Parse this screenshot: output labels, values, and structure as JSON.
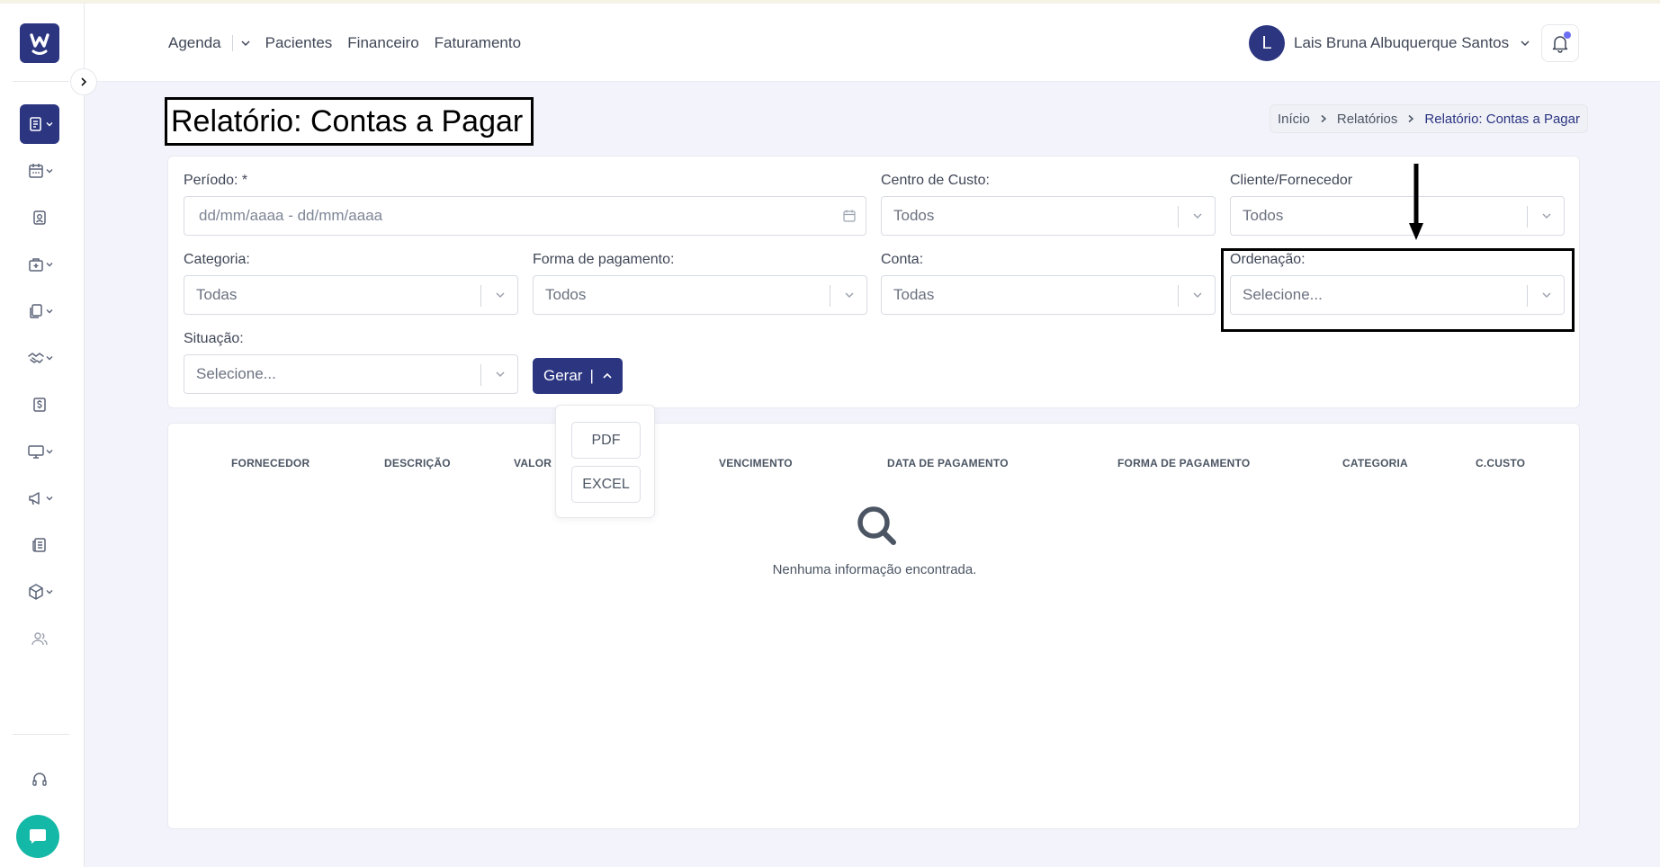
{
  "header": {
    "nav": [
      "Agenda",
      "Pacientes",
      "Financeiro",
      "Faturamento"
    ],
    "user_initial": "L",
    "user_name": "Lais Bruna Albuquerque Santos"
  },
  "page": {
    "title": "Relatório: Contas a Pagar",
    "breadcrumb": [
      "Início",
      "Relatórios",
      "Relatório: Contas a Pagar"
    ]
  },
  "filters": {
    "periodo": {
      "label": "Período: *",
      "placeholder": "dd/mm/aaaa - dd/mm/aaaa"
    },
    "centro_custo": {
      "label": "Centro de Custo:",
      "value": "Todos"
    },
    "cliente_fornecedor": {
      "label": "Cliente/Fornecedor",
      "value": "Todos"
    },
    "categoria": {
      "label": "Categoria:",
      "value": "Todas"
    },
    "forma_pagamento": {
      "label": "Forma de pagamento:",
      "value": "Todos"
    },
    "conta": {
      "label": "Conta:",
      "value": "Todas"
    },
    "ordenacao": {
      "label": "Ordenação:",
      "value": "Selecione..."
    },
    "situacao": {
      "label": "Situação:",
      "value": "Selecione..."
    }
  },
  "gerar": {
    "label": "Gerar",
    "separator": "|",
    "options": [
      "PDF",
      "EXCEL"
    ]
  },
  "table": {
    "columns": [
      "FORNECEDOR",
      "DESCRIÇÃO",
      "VALOR",
      "VENCIMENTO",
      "DATA DE PAGAMENTO",
      "FORMA DE PAGAMENTO",
      "CATEGORIA",
      "C.CUSTO"
    ],
    "empty_message": "Nenhuma informação encontrada."
  },
  "colors": {
    "primary": "#2b3580",
    "chat": "#14b8a6",
    "notification": "#6d6ff3"
  },
  "icons": {
    "sidebar": [
      "report-icon",
      "calendar-icon",
      "patient-icon",
      "medical-kit-icon",
      "documents-icon",
      "handshake-icon",
      "dollar-icon",
      "monitor-icon",
      "megaphone-icon",
      "newspaper-icon",
      "box-icon",
      "users-icon",
      "headset-icon"
    ]
  }
}
